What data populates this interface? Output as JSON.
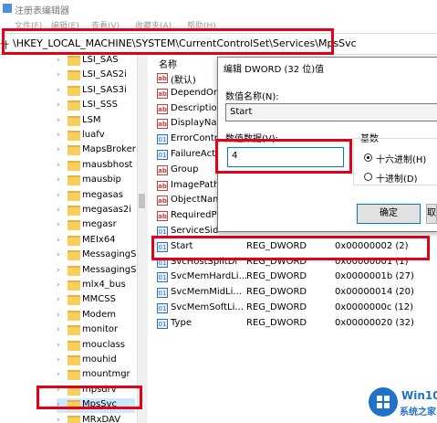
{
  "window": {
    "title": "注册表编辑器"
  },
  "menu": [
    "文件(F)",
    "编辑(E)",
    "查看(V)",
    "收藏夹(A)",
    "帮助(H)"
  ],
  "address": {
    "label": "计算",
    "path": "\\HKEY_LOCAL_MACHINE\\SYSTEM\\CurrentControlSet\\Services\\MpsSvc"
  },
  "tree": {
    "items": [
      "LSI_SAS",
      "LSI_SAS2i",
      "LSI_SAS3i",
      "LSI_SSS",
      "LSM",
      "luafv",
      "MapsBroker",
      "mausbhost",
      "mausbip",
      "megasas",
      "megasas2i",
      "megasr",
      "MEIx64",
      "MessagingSe",
      "MessagingSe",
      "mlx4_bus",
      "MMCSS",
      "Modem",
      "monitor",
      "mouclass",
      "mouhid",
      "mountmgr",
      "mpsdrv",
      "MpsSvc",
      "MRxDAV"
    ],
    "selected": "MpsSvc"
  },
  "values": {
    "header_name": "名称",
    "rows": [
      {
        "icon": "ab",
        "name": "(默认)",
        "type": "",
        "data": ""
      },
      {
        "icon": "ab",
        "name": "DependOn",
        "type": "",
        "data": ""
      },
      {
        "icon": "ab",
        "name": "Description",
        "type": "",
        "data": ""
      },
      {
        "icon": "ab",
        "name": "DisplayNam",
        "type": "",
        "data": ""
      },
      {
        "icon": "bin",
        "name": "ErrorContr",
        "type": "",
        "data": ""
      },
      {
        "icon": "bin",
        "name": "FailureActi",
        "type": "",
        "data": ""
      },
      {
        "icon": "ab",
        "name": "Group",
        "type": "",
        "data": ""
      },
      {
        "icon": "ab",
        "name": "ImagePath",
        "type": "",
        "data": ""
      },
      {
        "icon": "ab",
        "name": "ObjectNam",
        "type": "",
        "data": ""
      },
      {
        "icon": "ab",
        "name": "RequiredPr",
        "type": "",
        "data": ""
      },
      {
        "icon": "bin",
        "name": "ServiceSid",
        "type": "",
        "data": ""
      },
      {
        "icon": "bin",
        "name": "Start",
        "type": "REG_DWORD",
        "data": "0x00000002 (2)"
      },
      {
        "icon": "bin",
        "name": "SvcHostSplitDi",
        "type": "REG_DWORD",
        "data": "0x00000001 (1)"
      },
      {
        "icon": "bin",
        "name": "SvcMemHardLi...",
        "type": "REG_DWORD",
        "data": "0x0000001b (27)"
      },
      {
        "icon": "bin",
        "name": "SvcMemMidLi...",
        "type": "REG_DWORD",
        "data": "0x00000014 (20)"
      },
      {
        "icon": "bin",
        "name": "SvcMemSoftLi...",
        "type": "REG_DWORD",
        "data": "0x0000000c (12)"
      },
      {
        "icon": "bin",
        "name": "Type",
        "type": "REG_DWORD",
        "data": "0x00000020 (32)"
      }
    ]
  },
  "dialog": {
    "title": "编辑 DWORD (32 位)值",
    "name_label": "数值名称(N):",
    "name_value": "Start",
    "data_label": "数值数据(V):",
    "data_value": "4",
    "base_label": "基数",
    "radio_hex": "十六进制(H)",
    "radio_dec": "十进制(D)",
    "ok": "确定",
    "cancel": "取消"
  },
  "watermark": {
    "brand": "Win10",
    "sub": "系统之家"
  },
  "colors": {
    "highlight": "#e3001b",
    "folder": "#f6cf5e",
    "win_blue": "#1e73c8"
  }
}
